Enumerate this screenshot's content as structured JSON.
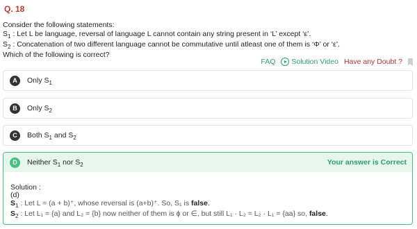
{
  "question": {
    "number": "Q. 18",
    "intro": "Consider the following statements:",
    "s1_label": "S",
    "s1_sub": "1",
    "s1_text": " : Let L be language, reversal of language L cannot contain any string present in ‘L’ except ‘ε’.",
    "s2_label": "S",
    "s2_sub": "2",
    "s2_text": " : Concatenation of two different language cannot be commutative until atleast one of them is ‘Φ’ or ‘ε’.",
    "prompt": "Which of the following is correct?"
  },
  "toolbar": {
    "faq": "FAQ",
    "solution_video": "Solution Video",
    "doubt": "Have any Doubt ?"
  },
  "options": [
    {
      "letter": "A",
      "t1": "Only S",
      "s1": "1",
      "t2": "",
      "s2": "",
      "t3": ""
    },
    {
      "letter": "B",
      "t1": "Only S",
      "s1": "2",
      "t2": "",
      "s2": "",
      "t3": ""
    },
    {
      "letter": "C",
      "t1": "Both S",
      "s1": "1",
      "t2": " and S",
      "s2": "2",
      "t3": ""
    },
    {
      "letter": "D",
      "t1": "Neither S",
      "s1": "1",
      "t2": " nor S",
      "s2": "2",
      "t3": ""
    }
  ],
  "result": {
    "status": "Your answer is Correct"
  },
  "solution": {
    "heading": "Solution :",
    "answer": "(d)",
    "l1_label": "S",
    "l1_sub": "1",
    "l1_text": " : Let L = (a + b)⁺, whose reversal is (a+b)⁺. So, S₁ is ",
    "l1_bold": "false",
    "l1_end": ".",
    "l2_label": "S",
    "l2_sub": "2",
    "l2_text": " : Let L₁ = {a} and L₂ = {b} now neither of them is ϕ or ∈, but still L₁ · L₂ = L₂ · L₁ = {aa} so, ",
    "l2_bold": "false",
    "l2_end": "."
  },
  "colors": {
    "question_number": "#c0392b",
    "accent_green": "#45c07e",
    "doubt_red": "#b03030"
  }
}
